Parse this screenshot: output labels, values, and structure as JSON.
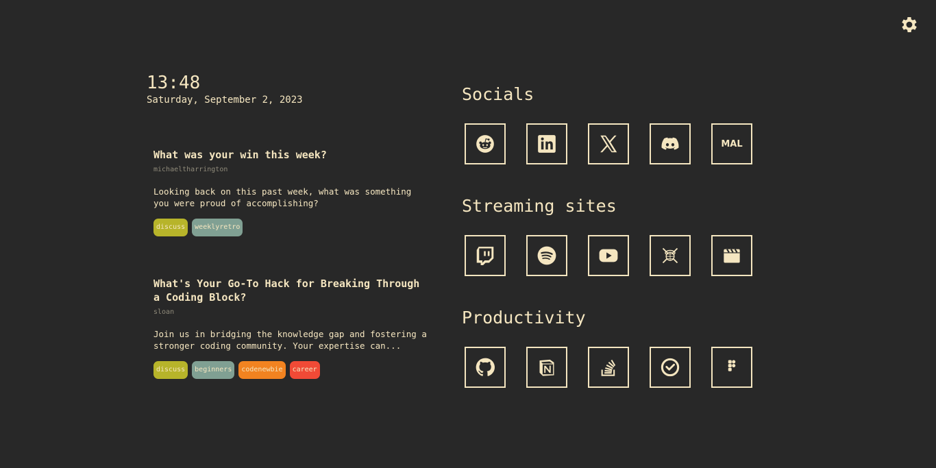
{
  "clock": {
    "time": "13:48",
    "date": "Saturday, September 2, 2023"
  },
  "posts": [
    {
      "title": "What was your win this week?",
      "author": "michaeltharrington",
      "description": "Looking back on this past week, what was something you were proud of accomplishing?",
      "tags": [
        {
          "label": "discuss",
          "color": "#b7b42a"
        },
        {
          "label": "weeklyretro",
          "color": "#80a093"
        }
      ]
    },
    {
      "title": "What's Your Go-To Hack for Breaking Through a Coding Block?",
      "author": "sloan",
      "description": "Join us in bridging the knowledge gap and fostering a stronger coding community. Your expertise can...",
      "tags": [
        {
          "label": "discuss",
          "color": "#b7b42a"
        },
        {
          "label": "beginners",
          "color": "#80a093"
        },
        {
          "label": "codenewbie",
          "color": "#f28320"
        },
        {
          "label": "career",
          "color": "#f04a36"
        }
      ]
    }
  ],
  "sections": {
    "socials": {
      "title": "Socials",
      "items": [
        "reddit-icon",
        "linkedin-icon",
        "x-icon",
        "discord-icon",
        "mal-icon"
      ],
      "mal_text": "MAL"
    },
    "streaming": {
      "title": "Streaming sites",
      "items": [
        "twitch-icon",
        "spotify-icon",
        "youtube-icon",
        "anime-site-icon",
        "clapperboard-icon"
      ]
    },
    "productivity": {
      "title": "Productivity",
      "items": [
        "github-icon",
        "notion-icon",
        "stackoverflow-icon",
        "todoist-icon",
        "figma-icon"
      ]
    }
  },
  "colors": {
    "background": "#282828",
    "foreground": "#f5e6c0",
    "muted": "#8f8a7a"
  }
}
